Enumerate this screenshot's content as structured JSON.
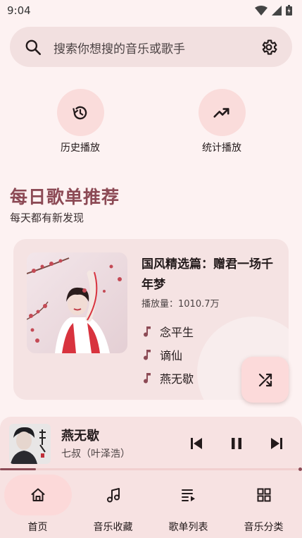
{
  "status_bar": {
    "time": "9:04"
  },
  "search": {
    "placeholder": "搜索你想搜的音乐或歌手"
  },
  "quick_actions": [
    {
      "label": "历史播放",
      "icon": "history-icon"
    },
    {
      "label": "统计播放",
      "icon": "trending-up-icon"
    }
  ],
  "section": {
    "title": "每日歌单推荐",
    "subtitle": "每天都有新发现"
  },
  "playlist": {
    "title": "国风精选篇：赠君一场千年梦",
    "play_count": "播放量：1010.7万",
    "songs": [
      "念平生",
      "谪仙",
      "燕无歇"
    ]
  },
  "now_playing": {
    "title": "燕无歇",
    "artist": "七叔（叶泽浩）",
    "progress": 0.12
  },
  "nav": [
    {
      "label": "首页",
      "icon": "home-icon",
      "active": true
    },
    {
      "label": "音乐收藏",
      "icon": "music-note-icon",
      "active": false
    },
    {
      "label": "歌单列表",
      "icon": "playlist-icon",
      "active": false
    },
    {
      "label": "音乐分类",
      "icon": "category-icon",
      "active": false
    }
  ],
  "colors": {
    "accent": "#8c4a55",
    "background": "#fdf2f2",
    "surface": "#f7e2e2"
  }
}
